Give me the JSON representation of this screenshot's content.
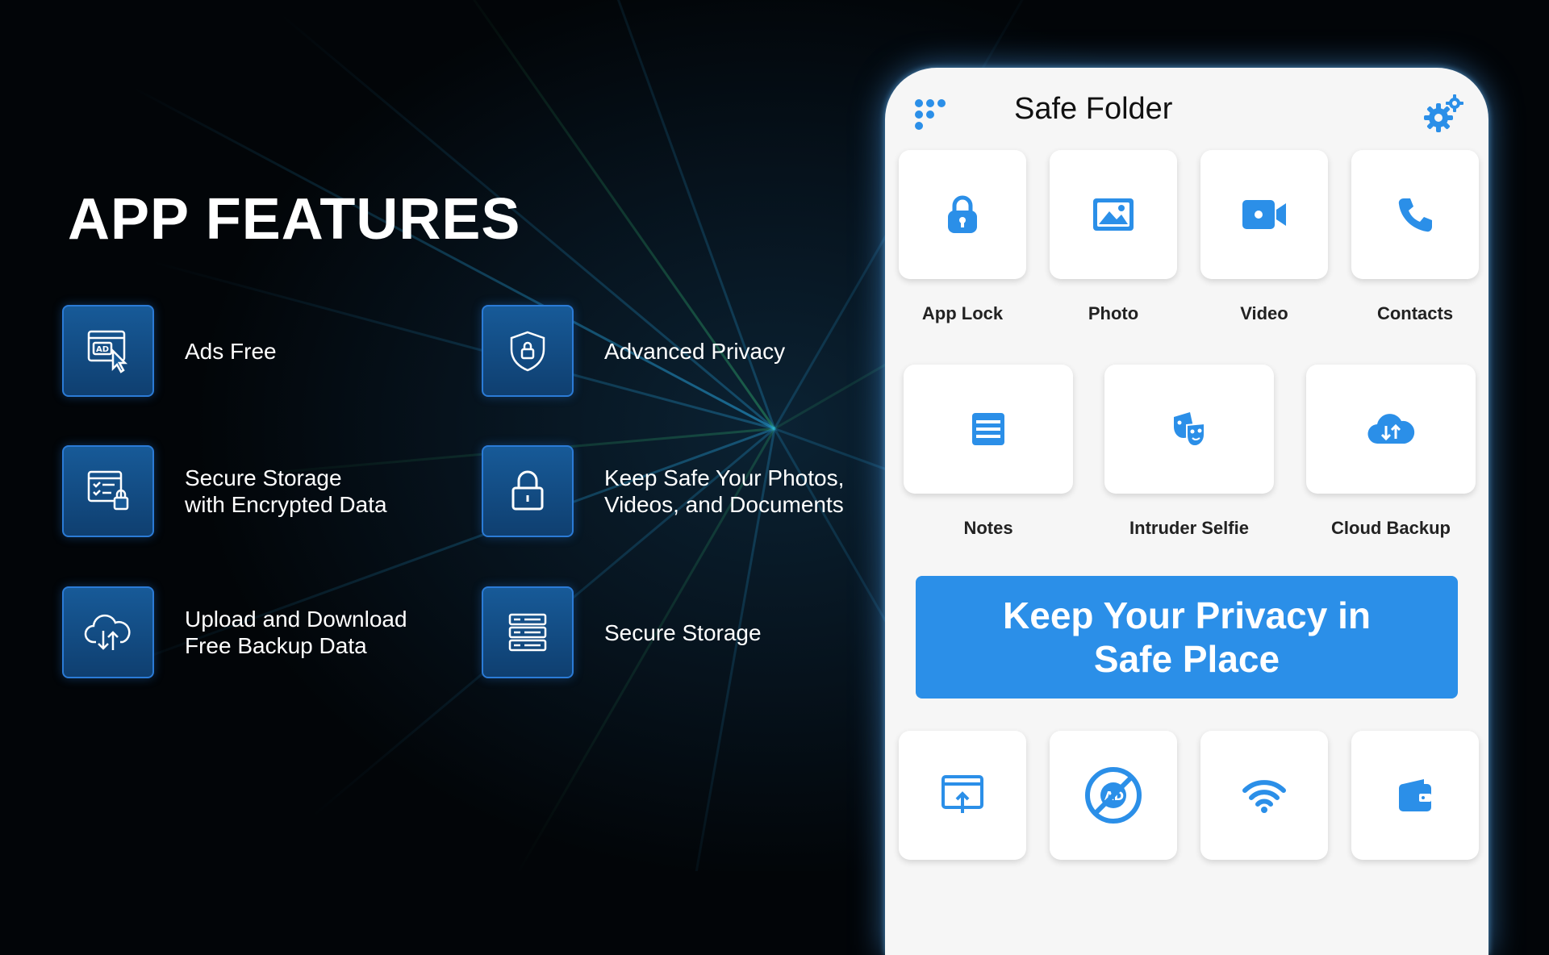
{
  "heading": "APP FEATURES",
  "features": [
    {
      "icon": "ad-block-icon",
      "lines": [
        "Ads Free"
      ]
    },
    {
      "icon": "shield-lock-icon",
      "lines": [
        "Advanced Privacy"
      ]
    },
    {
      "icon": "secure-storage-icon",
      "lines": [
        "Secure Storage",
        "with Encrypted Data"
      ]
    },
    {
      "icon": "padlock-icon",
      "lines": [
        "Keep Safe Your Photos,",
        "Videos, and Documents"
      ]
    },
    {
      "icon": "cloud-sync-icon",
      "lines": [
        "Upload and Download",
        "Free Backup Data"
      ]
    },
    {
      "icon": "server-icon",
      "lines": [
        "Secure Storage"
      ]
    }
  ],
  "app": {
    "title": "Safe Folder",
    "row1": [
      {
        "label": "App Lock",
        "icon": "lock-icon"
      },
      {
        "label": "Photo",
        "icon": "photo-icon"
      },
      {
        "label": "Video",
        "icon": "video-icon"
      },
      {
        "label": "Contacts",
        "icon": "phone-icon"
      }
    ],
    "row2": [
      {
        "label": "Notes",
        "icon": "notes-icon"
      },
      {
        "label": "Intruder Selfie",
        "icon": "intruder-icon"
      },
      {
        "label": "Cloud Backup",
        "icon": "cloud-backup-icon"
      }
    ],
    "banner_lines": [
      "Keep Your Privacy in",
      "Safe Place"
    ],
    "row3": [
      {
        "icon": "browser-upload-icon"
      },
      {
        "icon": "ad-free-icon"
      },
      {
        "icon": "wifi-icon"
      },
      {
        "icon": "wallet-icon"
      }
    ]
  },
  "colors": {
    "accent": "#2b8fe8",
    "feature_icon_bg": "#175a98",
    "background": "#020508"
  }
}
